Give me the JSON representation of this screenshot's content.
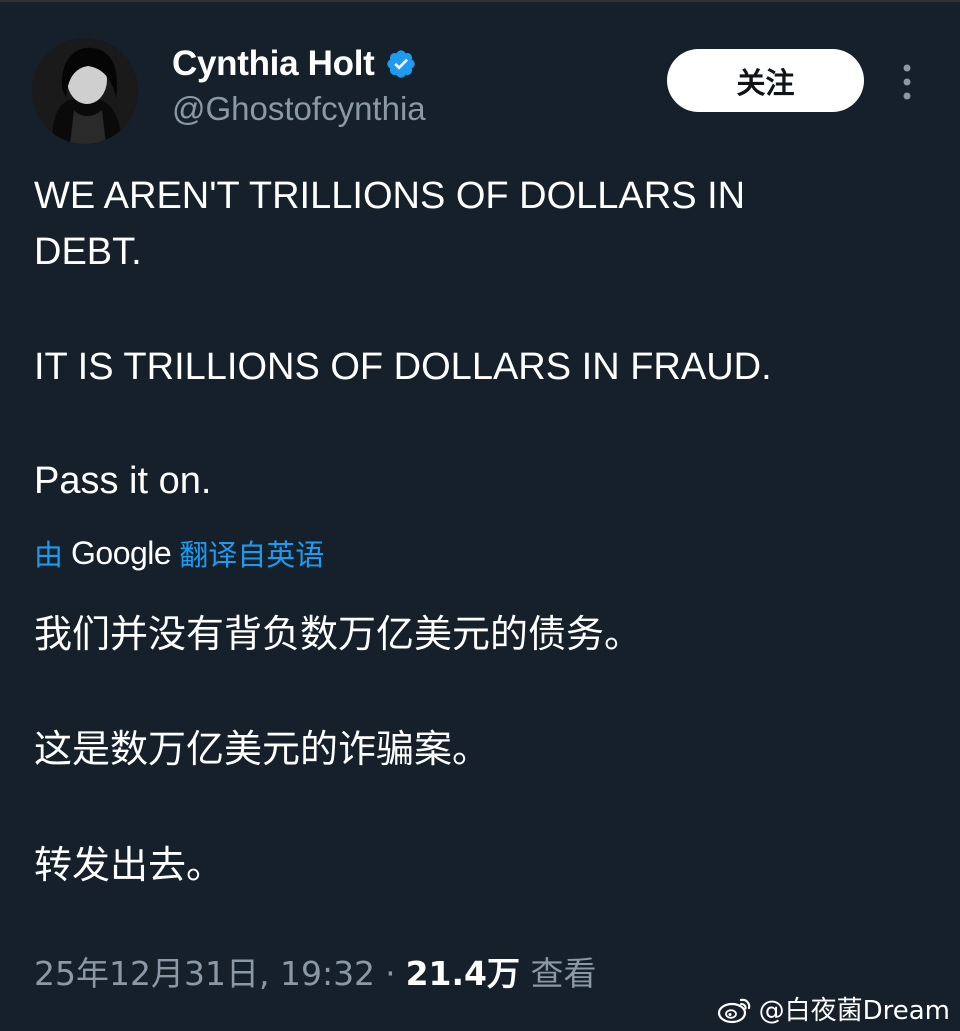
{
  "user": {
    "display_name": "Cynthia Holt",
    "handle": "@Ghostofcynthia",
    "verified_color": "#1d9bf0"
  },
  "follow_button": {
    "label": "关注"
  },
  "tweet": {
    "lines": [
      "WE AREN'T TRILLIONS OF DOLLARS IN",
      "DEBT.",
      "IT IS TRILLIONS OF DOLLARS IN FRAUD.",
      "Pass it on."
    ]
  },
  "translation": {
    "prefix": "由",
    "provider": "Google",
    "suffix": "翻译自英语",
    "lines": [
      "我们并没有背负数万亿美元的债务。",
      "这是数万亿美元的诈骗案。",
      "转发出去。"
    ]
  },
  "meta": {
    "timestamp": "25年12月31日, 19:32",
    "separator": "·",
    "views": "21.4万",
    "views_label": "查看"
  },
  "watermark": {
    "text": "@白夜菌Dream"
  },
  "colors": {
    "background": "#15202b",
    "text": "#ffffff",
    "secondary": "#8b98a5",
    "accent": "#1d9bf0"
  }
}
